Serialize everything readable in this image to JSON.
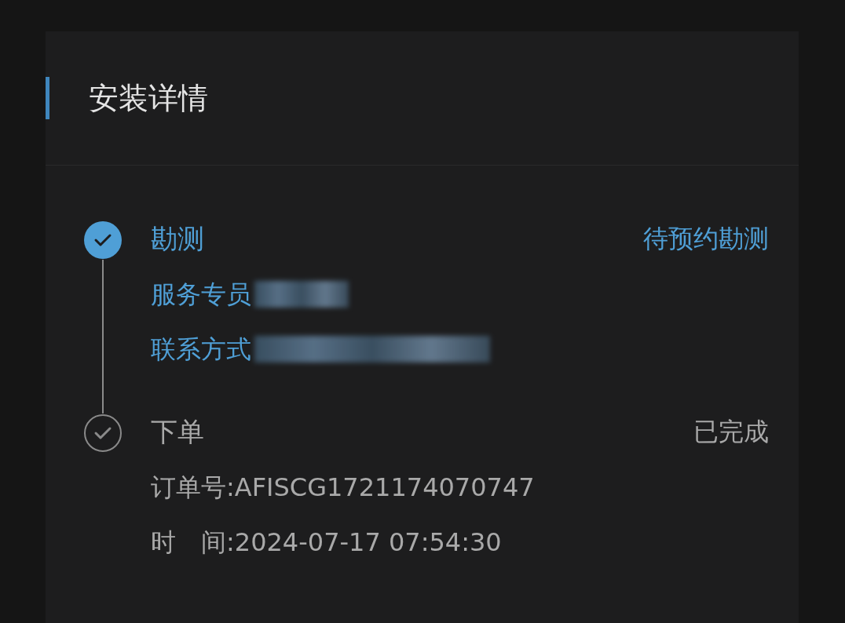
{
  "card": {
    "title": "安装详情"
  },
  "steps": [
    {
      "name": "勘测",
      "status": "待预约勘测",
      "active": true,
      "details": [
        {
          "text": "服务专员",
          "redacted": true
        },
        {
          "text": "联系方式",
          "redacted": true
        }
      ]
    },
    {
      "name": "下单",
      "status": "已完成",
      "active": false,
      "details": [
        {
          "text": "订单号:AFISCG1721174070747",
          "redacted": false
        },
        {
          "text": "时　间:2024-07-17 07:54:30",
          "redacted": false
        }
      ]
    }
  ]
}
